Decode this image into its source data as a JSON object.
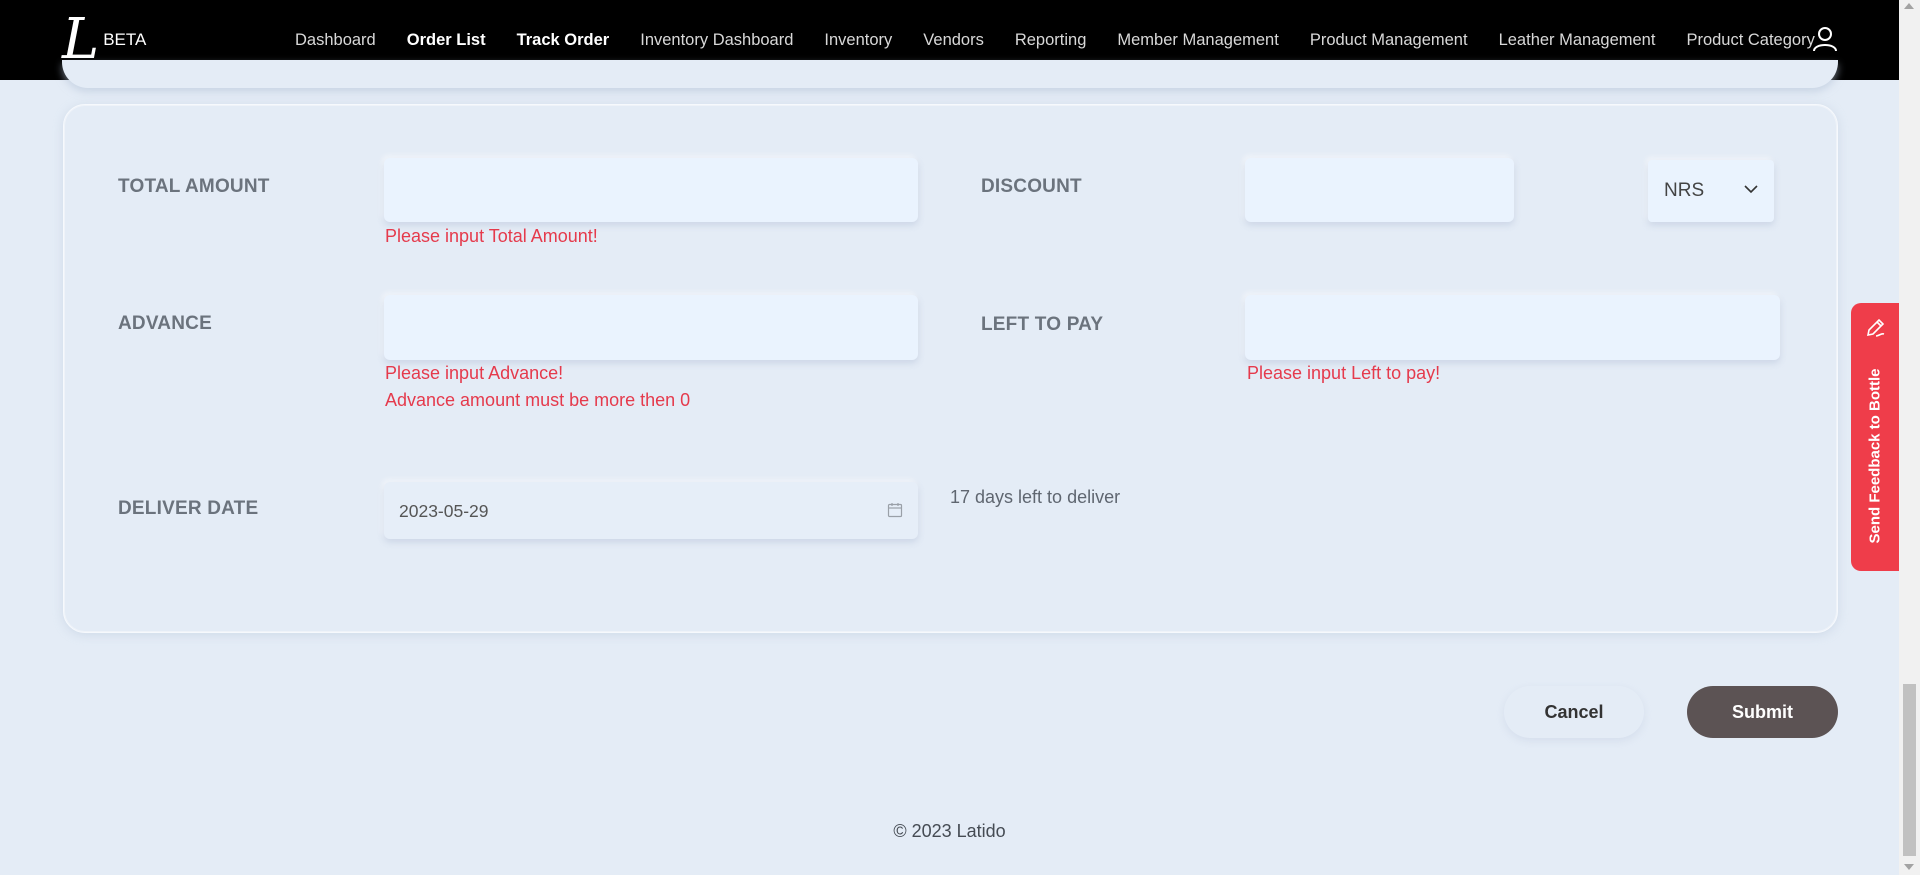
{
  "brand": {
    "logo_letter": "L",
    "badge": "BETA"
  },
  "nav": {
    "items": [
      {
        "label": "Dashboard",
        "active": false
      },
      {
        "label": "Order List",
        "active": true
      },
      {
        "label": "Track Order",
        "active": true
      },
      {
        "label": "Inventory Dashboard",
        "active": false
      },
      {
        "label": "Inventory",
        "active": false
      },
      {
        "label": "Vendors",
        "active": false
      },
      {
        "label": "Reporting",
        "active": false
      },
      {
        "label": "Member Management",
        "active": false
      },
      {
        "label": "Product Management",
        "active": false
      },
      {
        "label": "Leather Management",
        "active": false
      },
      {
        "label": "Product Category",
        "active": false
      }
    ],
    "user_icon": "user-icon"
  },
  "form": {
    "total_amount": {
      "label": "TOTAL AMOUNT",
      "value": "",
      "error": "Please input Total Amount!"
    },
    "discount": {
      "label": "DISCOUNT",
      "value": "",
      "currency": "NRS"
    },
    "advance": {
      "label": "ADVANCE",
      "value": "",
      "errors": [
        "Please input Advance!",
        "Advance amount must be more then 0"
      ]
    },
    "left_to_pay": {
      "label": "LEFT TO PAY",
      "value": "",
      "error": "Please input Left to pay!"
    },
    "deliver_date": {
      "label": "DELIVER DATE",
      "value": "2023-05-29",
      "note": "17 days left to deliver",
      "icon": "calendar-icon"
    }
  },
  "actions": {
    "cancel": "Cancel",
    "submit": "Submit"
  },
  "footer": {
    "text": "© 2023 Latido"
  },
  "feedback": {
    "label": "Send Feedback to Bottle",
    "icon": "pencil-icon"
  },
  "colors": {
    "nav_bg": "#000000",
    "error": "#e53a4c",
    "submit_bg": "#5c5354",
    "feedback_bg": "#ef3d4a",
    "page_bg": "#e4ecf6"
  }
}
